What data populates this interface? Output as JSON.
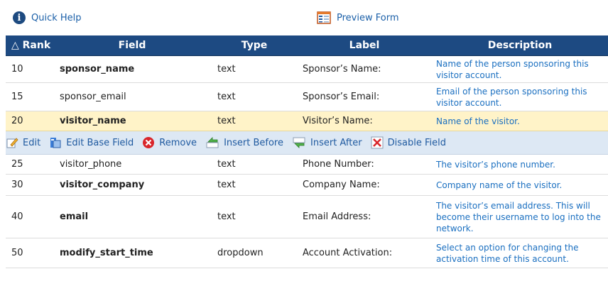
{
  "top": {
    "quick_help": "Quick Help",
    "preview_form": "Preview Form"
  },
  "headers": {
    "rank": "△ Rank",
    "field": "Field",
    "type": "Type",
    "label": "Label",
    "description": "Description"
  },
  "rows": [
    {
      "rank": "10",
      "field": "sponsor_name",
      "type": "text",
      "label": "Sponsor’s Name:",
      "description": "Name of the person sponsoring this visitor account."
    },
    {
      "rank": "15",
      "field": "sponsor_email",
      "type": "text",
      "label": "Sponsor’s Email:",
      "description": "Email of the person sponsoring this visitor account."
    },
    {
      "rank": "20",
      "field": "visitor_name",
      "type": "text",
      "label": "Visitor’s Name:",
      "description": "Name of the visitor."
    },
    {
      "rank": "25",
      "field": "visitor_phone",
      "type": "text",
      "label": "Phone Number:",
      "description": "The visitor’s phone number."
    },
    {
      "rank": "30",
      "field": "visitor_company",
      "type": "text",
      "label": "Company Name:",
      "description": "Company name of the visitor."
    },
    {
      "rank": "40",
      "field": "email",
      "type": "text",
      "label": "Email Address:",
      "description": "The visitor’s email address. This will become their username to log into the network."
    },
    {
      "rank": "50",
      "field": "modify_start_time",
      "type": "dropdown",
      "label": "Account Activation:",
      "description": "Select an option for changing the activation time of this account."
    }
  ],
  "actions": {
    "edit": "Edit",
    "edit_base": "Edit Base Field",
    "remove": "Remove",
    "insert_before": "Insert Before",
    "insert_after": "Insert After",
    "disable": "Disable Field"
  }
}
